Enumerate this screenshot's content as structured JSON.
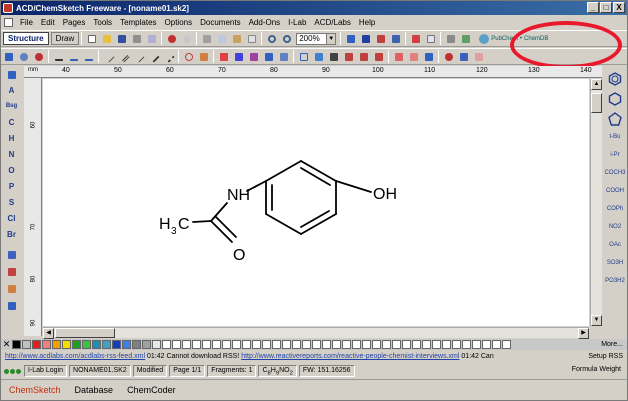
{
  "window": {
    "title": "ACD/ChemSketch Freeware - [noname01.sk2]",
    "minimize": "_",
    "maximize": "□",
    "close": "X"
  },
  "menu": [
    "File",
    "Edit",
    "Pages",
    "Tools",
    "Templates",
    "Options",
    "Documents",
    "Add-Ons",
    "I-Lab",
    "ACD/Labs",
    "Help"
  ],
  "toolbar": {
    "mode_structure": "Structure",
    "mode_draw": "Draw",
    "zoom": "200%",
    "pubchem_label": "PubChem",
    "pubchem_sep": "•",
    "chemdb_label": "ChemDB"
  },
  "left_palette": [
    "A",
    "Bsg",
    "C",
    "H",
    "N",
    "O",
    "P",
    "S",
    "Cl",
    "Br"
  ],
  "ruler": {
    "unit": "mm",
    "x_ticks": [
      "40",
      "50",
      "60",
      "70",
      "80",
      "90",
      "100",
      "110",
      "120",
      "130",
      "140"
    ],
    "y_ticks": [
      "60",
      "70",
      "80",
      "90"
    ]
  },
  "molecule": {
    "label_h3c": "H",
    "label_sub3": "3",
    "label_c": "C",
    "label_nh": "NH",
    "label_oh": "OH",
    "label_o": "O"
  },
  "right_palette": [
    "t-Bu",
    "i-Pr",
    "COCH3",
    "COOH",
    "COPh",
    "NO2",
    "OAc",
    "SO3H",
    "PO3H2"
  ],
  "colors": {
    "palette": [
      "#000000",
      "#c0c0c0",
      "#e02020",
      "#f08080",
      "#f0a000",
      "#f0e000",
      "#20a020",
      "#40c040",
      "#2090b0",
      "#40a0c0",
      "#1040c0",
      "#4080e0",
      "#808080",
      "#a0a0a0",
      "#e8e8e8",
      "#ffffff",
      "#ffffff",
      "#ffffff",
      "#ffffff",
      "#ffffff",
      "#ffffff",
      "#ffffff",
      "#ffffff",
      "#ffffff",
      "#ffffff",
      "#ffffff",
      "#ffffff",
      "#ffffff",
      "#ffffff",
      "#ffffff",
      "#ffffff",
      "#ffffff",
      "#ffffff",
      "#ffffff",
      "#ffffff",
      "#ffffff",
      "#ffffff",
      "#ffffff",
      "#ffffff",
      "#ffffff",
      "#ffffff",
      "#ffffff",
      "#ffffff",
      "#ffffff",
      "#ffffff",
      "#ffffff",
      "#ffffff",
      "#ffffff",
      "#ffffff",
      "#ffffff"
    ],
    "more": "More...",
    "highlight": "#e8192c"
  },
  "rss": {
    "link1": "http://www.acdlabs.com/acdlabs-rss-feed.xml",
    "msg1": "01:42 Cannot download RSS!",
    "link2": "http://www.reactivereports.com/reactive-people-chemist-interviews.xml",
    "msg2": "01:42 Can",
    "setup": "Setup RSS"
  },
  "status": {
    "ilab_login": "I-Lab Login",
    "filename": "NONAME01.SK2",
    "modified": "Modified",
    "page": "Page 1/1",
    "fragments": "Fragments: 1",
    "formula_c": "C",
    "formula_csub": "8",
    "formula_h": "H",
    "formula_hsub": "9",
    "formula_no": "NO",
    "formula_osub": "2",
    "fw": "FW: 151.16256",
    "formula_weight": "Formula Weight"
  },
  "apps": [
    "ChemSketch",
    "Database",
    "ChemCoder"
  ]
}
